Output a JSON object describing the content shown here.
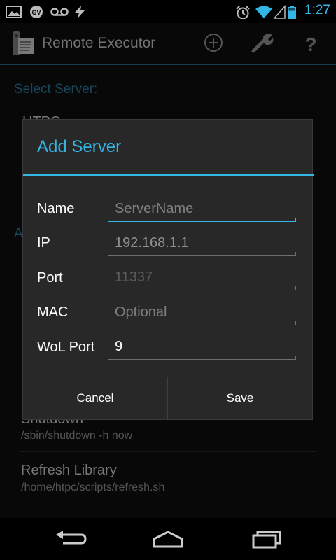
{
  "status_bar": {
    "time": "1:27",
    "icons": [
      "image-icon",
      "google-voice-icon",
      "voicemail-icon",
      "flash-icon",
      "alarm-icon",
      "wifi-icon",
      "signal-icon",
      "battery-icon"
    ]
  },
  "app": {
    "title": "Remote Executor",
    "actions": [
      "add-icon",
      "wrench-icon",
      "help-icon"
    ],
    "select_server_label": "Select Server:",
    "partial_server_name": "HTPC",
    "partial_section_letter": "A",
    "commands": [
      {
        "title": "Shutdown",
        "command": "/sbin/shutdown -h now"
      },
      {
        "title": "Refresh Library",
        "command": "/home/htpc/scripts/refresh.sh"
      }
    ]
  },
  "dialog": {
    "title": "Add Server",
    "fields": [
      {
        "label": "Name",
        "value": "",
        "placeholder": "ServerName"
      },
      {
        "label": "IP",
        "value": "",
        "placeholder": "192.168.1.1"
      },
      {
        "label": "Port",
        "value": "",
        "placeholder": "11337"
      },
      {
        "label": "MAC",
        "value": "",
        "placeholder": "Optional"
      },
      {
        "label": "WoL Port",
        "value": "9",
        "placeholder": ""
      }
    ],
    "cancel_label": "Cancel",
    "save_label": "Save"
  },
  "colors": {
    "accent": "#33b5e5",
    "dialog_bg": "#282828"
  }
}
